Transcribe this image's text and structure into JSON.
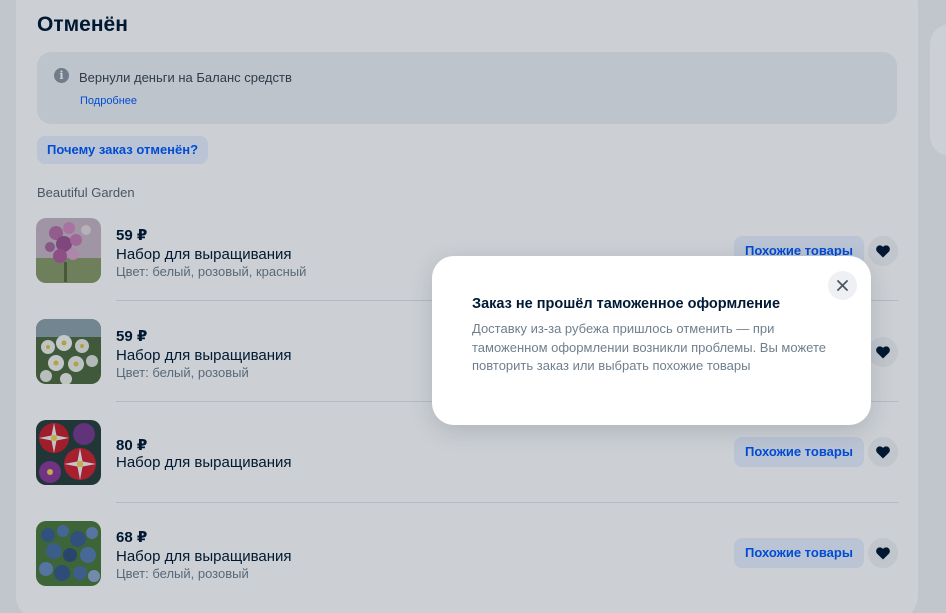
{
  "order": {
    "status_title": "Отменён"
  },
  "info": {
    "icon": "info-icon",
    "message": "Вернули деньги на Баланс средств",
    "link": "Подробнее"
  },
  "why_button": "Почему заказ отменён?",
  "seller": "Beautiful Garden",
  "items": [
    {
      "price": "59 ₽",
      "name": "Набор для выращивания",
      "attributes": "Цвет: белый, розовый, красный",
      "similar": "Похожие товары",
      "favorite_icon": "heart-icon"
    },
    {
      "price": "59 ₽",
      "name": "Набор для выращивания",
      "attributes": "Цвет: белый, розовый",
      "similar": "Похожие товары",
      "favorite_icon": "heart-icon"
    },
    {
      "price": "80 ₽",
      "name": "Набор для выращивания",
      "attributes": "",
      "similar": "Похожие товары",
      "favorite_icon": "heart-icon"
    },
    {
      "price": "68 ₽",
      "name": "Набор для выращивания",
      "attributes": "Цвет: белый, розовый",
      "similar": "Похожие товары",
      "favorite_icon": "heart-icon"
    }
  ],
  "modal": {
    "title": "Заказ не прошёл таможенное оформление",
    "text": "Доставку из-за рубежа пришлось отменить — при таможенном оформлении возникли проблемы. Вы можете повторить заказ или выбрать похожие товары",
    "close_icon": "close-icon"
  },
  "colors": {
    "accent": "#005bff",
    "text": "#001a34",
    "muted": "#707f8d"
  }
}
